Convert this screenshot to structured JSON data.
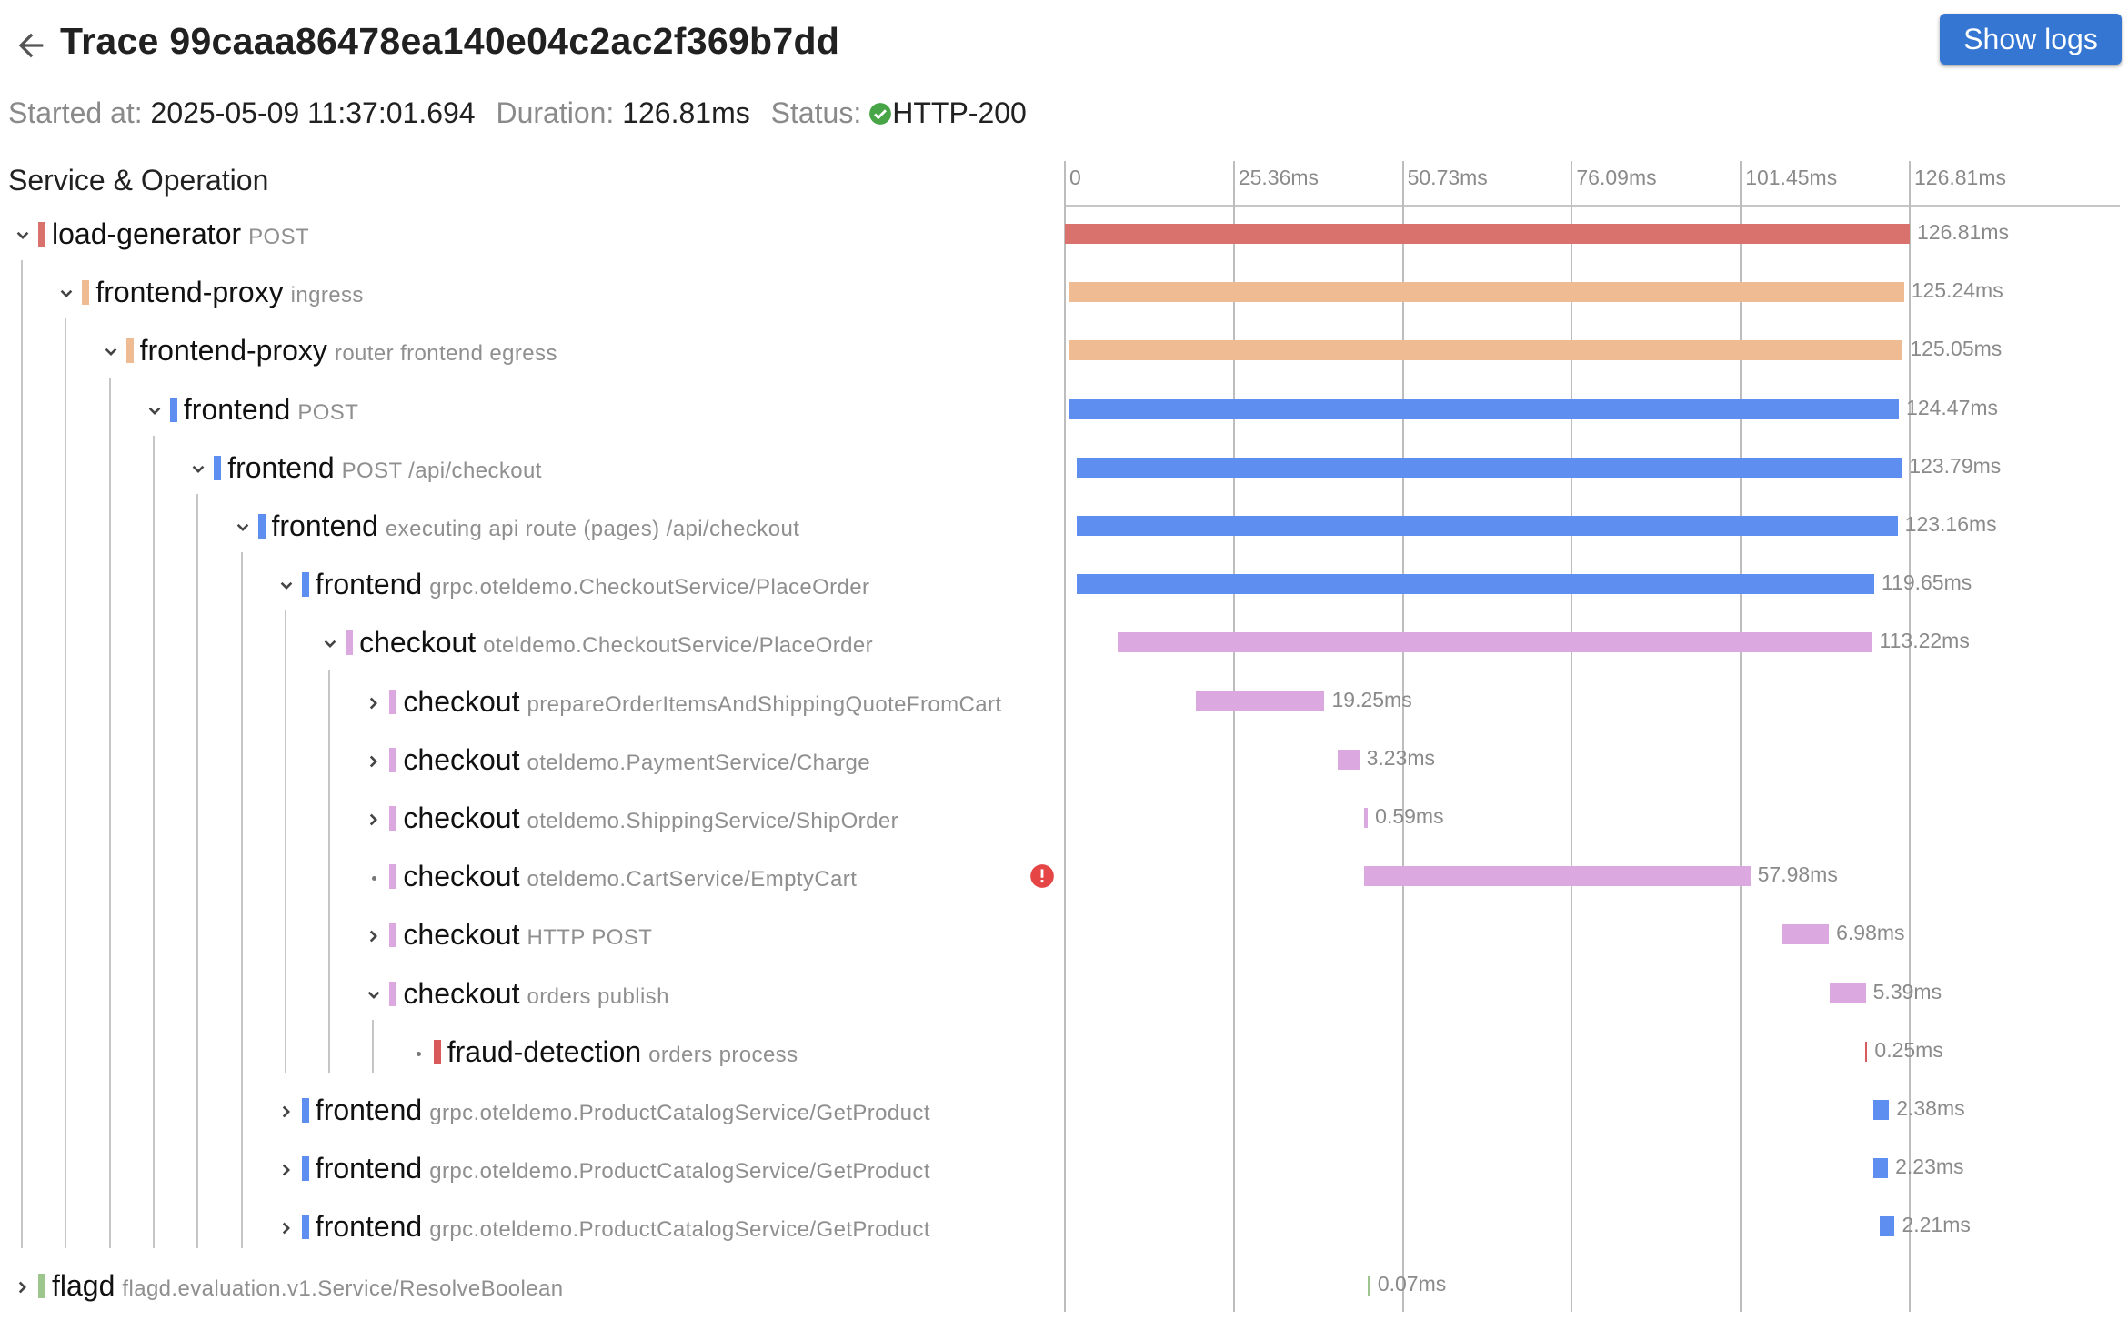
{
  "header": {
    "title": "Trace 99caaa86478ea140e04c2ac2f369b7dd",
    "show_logs_label": "Show logs"
  },
  "meta": {
    "started_label": "Started at:",
    "started_value": "2025-05-09 11:37:01.694",
    "duration_label": "Duration:",
    "duration_value": "126.81ms",
    "status_label": "Status:",
    "status_value": "HTTP-200",
    "status_icon": "check-circle-icon"
  },
  "tree": {
    "column_header": "Service & Operation"
  },
  "timeline": {
    "total_ms": 126.81,
    "ticks": [
      "0",
      "25.36ms",
      "50.73ms",
      "76.09ms",
      "101.45ms",
      "126.81ms"
    ]
  },
  "colors": {
    "load-generator": "#d9716d",
    "frontend-proxy": "#efbb92",
    "frontend": "#5e8ff0",
    "checkout": "#dca8e0",
    "fraud-detection": "#d85a5a",
    "flagd": "#9cc68e",
    "error": "#e54545",
    "ok": "#47a447",
    "button": "#3476d2"
  },
  "spans": [
    {
      "service": "load-generator",
      "operation": "POST",
      "depth": 0,
      "toggle": "expanded",
      "start_ms": 0.0,
      "duration_ms": 126.81,
      "duration_label": "126.81ms"
    },
    {
      "service": "frontend-proxy",
      "operation": "ingress",
      "depth": 1,
      "toggle": "expanded",
      "start_ms": 0.71,
      "duration_ms": 125.24,
      "duration_label": "125.24ms"
    },
    {
      "service": "frontend-proxy",
      "operation": "router frontend egress",
      "depth": 2,
      "toggle": "expanded",
      "start_ms": 0.71,
      "duration_ms": 125.05,
      "duration_label": "125.05ms"
    },
    {
      "service": "frontend",
      "operation": "POST",
      "depth": 3,
      "toggle": "expanded",
      "start_ms": 0.71,
      "duration_ms": 124.47,
      "duration_label": "124.47ms"
    },
    {
      "service": "frontend",
      "operation": "POST /api/checkout",
      "depth": 4,
      "toggle": "expanded",
      "start_ms": 1.83,
      "duration_ms": 123.79,
      "duration_label": "123.79ms"
    },
    {
      "service": "frontend",
      "operation": "executing api route (pages) /api/checkout",
      "depth": 5,
      "toggle": "expanded",
      "start_ms": 1.83,
      "duration_ms": 123.16,
      "duration_label": "123.16ms"
    },
    {
      "service": "frontend",
      "operation": "grpc.oteldemo.CheckoutService/PlaceOrder",
      "depth": 6,
      "toggle": "expanded",
      "start_ms": 1.83,
      "duration_ms": 119.65,
      "duration_label": "119.65ms"
    },
    {
      "service": "checkout",
      "operation": "oteldemo.CheckoutService/PlaceOrder",
      "depth": 7,
      "toggle": "expanded",
      "start_ms": 7.93,
      "duration_ms": 113.22,
      "duration_label": "113.22ms"
    },
    {
      "service": "checkout",
      "operation": "prepareOrderItemsAndShippingQuoteFromCart",
      "depth": 8,
      "toggle": "collapsed",
      "start_ms": 19.72,
      "duration_ms": 19.25,
      "duration_label": "19.25ms"
    },
    {
      "service": "checkout",
      "operation": "oteldemo.PaymentService/Charge",
      "depth": 8,
      "toggle": "collapsed",
      "start_ms": 40.94,
      "duration_ms": 3.23,
      "duration_label": "3.23ms"
    },
    {
      "service": "checkout",
      "operation": "oteldemo.ShippingService/ShipOrder",
      "depth": 8,
      "toggle": "collapsed",
      "start_ms": 44.89,
      "duration_ms": 0.59,
      "duration_label": "0.59ms"
    },
    {
      "service": "checkout",
      "operation": "oteldemo.CartService/EmptyCart",
      "depth": 8,
      "toggle": "leaf",
      "error": true,
      "start_ms": 44.89,
      "duration_ms": 57.98,
      "duration_label": "57.98ms"
    },
    {
      "service": "checkout",
      "operation": "HTTP POST",
      "depth": 8,
      "toggle": "collapsed",
      "start_ms": 107.7,
      "duration_ms": 6.98,
      "duration_label": "6.98ms"
    },
    {
      "service": "checkout",
      "operation": "orders publish",
      "depth": 8,
      "toggle": "expanded",
      "start_ms": 114.82,
      "duration_ms": 5.39,
      "duration_label": "5.39ms"
    },
    {
      "service": "fraud-detection",
      "operation": "orders process",
      "depth": 9,
      "toggle": "leaf",
      "start_ms": 120.11,
      "duration_ms": 0.25,
      "duration_label": "0.25ms"
    },
    {
      "service": "frontend",
      "operation": "grpc.oteldemo.ProductCatalogService/GetProduct",
      "depth": 6,
      "toggle": "collapsed",
      "start_ms": 121.32,
      "duration_ms": 2.38,
      "duration_label": "2.38ms"
    },
    {
      "service": "frontend",
      "operation": "grpc.oteldemo.ProductCatalogService/GetProduct",
      "depth": 6,
      "toggle": "collapsed",
      "start_ms": 121.32,
      "duration_ms": 2.23,
      "duration_label": "2.23ms"
    },
    {
      "service": "frontend",
      "operation": "grpc.oteldemo.ProductCatalogService/GetProduct",
      "depth": 6,
      "toggle": "collapsed",
      "start_ms": 122.34,
      "duration_ms": 2.21,
      "duration_label": "2.21ms"
    },
    {
      "service": "flagd",
      "operation": "flagd.evaluation.v1.Service/ResolveBoolean",
      "depth": 0,
      "toggle": "collapsed",
      "start_ms": 45.5,
      "duration_ms": 0.07,
      "duration_label": "0.07ms"
    }
  ]
}
